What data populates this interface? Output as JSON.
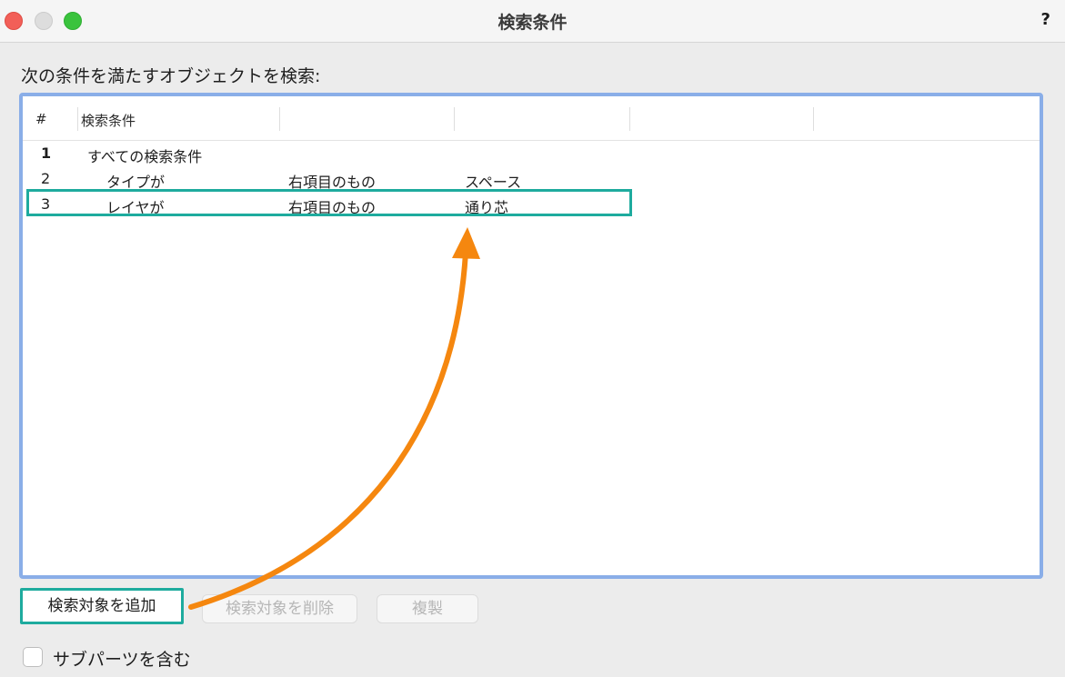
{
  "window": {
    "title": "検索条件",
    "help_label": "?"
  },
  "instruction": "次の条件を満たすオブジェクトを検索:",
  "table": {
    "headers": [
      "#",
      "検索条件",
      "",
      "",
      "",
      ""
    ],
    "rows": [
      {
        "num": "1",
        "criterion": "すべての検索条件",
        "operator": "",
        "value": ""
      },
      {
        "num": "2",
        "criterion": "タイプが",
        "operator": "右項目のもの",
        "value": "スペース"
      },
      {
        "num": "3",
        "criterion": "レイヤが",
        "operator": "右項目のもの",
        "value": "通り芯"
      }
    ]
  },
  "buttons": {
    "add": "検索対象を追加",
    "delete": "検索対象を削除",
    "duplicate": "複製"
  },
  "include_subparts": {
    "label": "サブパーツを含む",
    "checked": false
  },
  "annotation_colors": {
    "highlight": "#1eab9e",
    "arrow": "#f5870f",
    "focus_ring": "#8aaee8"
  }
}
